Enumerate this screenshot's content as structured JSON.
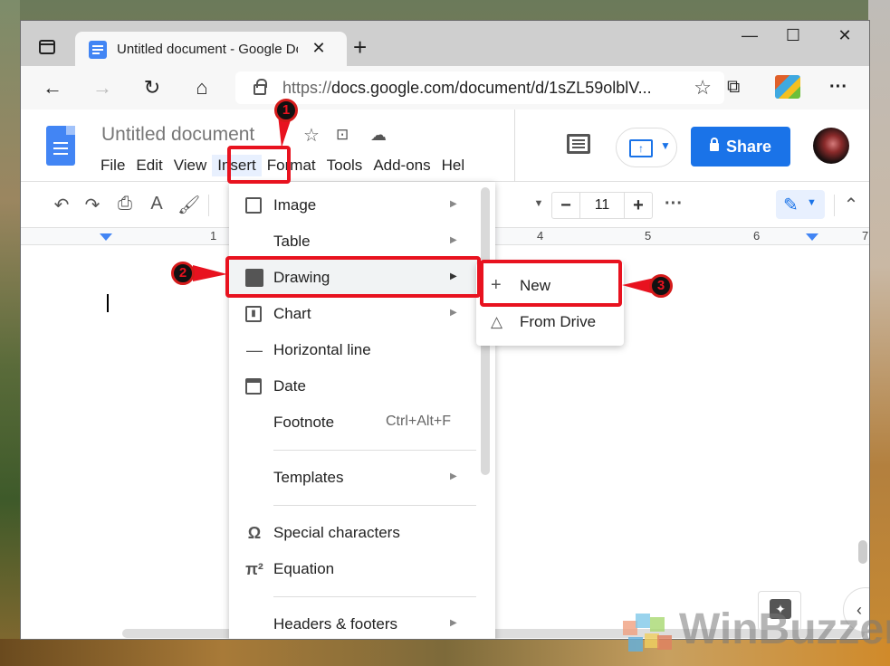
{
  "browser": {
    "tab_title": "Untitled document - Google Doc",
    "address_url_prefix": "https://",
    "address_url_rest": "docs.google.com/document/d/1sZL59olblV...",
    "window_controls": {
      "minimize": "—",
      "maximize": "☐",
      "close": "✕"
    }
  },
  "docs": {
    "doc_title": "Untitled document",
    "menubar": [
      "File",
      "Edit",
      "View",
      "Insert",
      "Format",
      "Tools",
      "Add-ons",
      "Hel"
    ],
    "active_menu": "Insert",
    "share_label": "Share",
    "font_size": "11",
    "ruler_numbers": [
      "1",
      "4",
      "5",
      "6",
      "7"
    ]
  },
  "insert_menu": {
    "items": [
      {
        "label": "Image",
        "icon": "image-icon",
        "has_submenu": true
      },
      {
        "label": "Table",
        "icon": "",
        "has_submenu": true
      },
      {
        "label": "Drawing",
        "icon": "drawing-icon",
        "has_submenu": true,
        "highlighted": true
      },
      {
        "label": "Chart",
        "icon": "chart-icon",
        "has_submenu": true
      },
      {
        "label": "Horizontal line",
        "icon": "horizontal-line-icon",
        "has_submenu": false
      },
      {
        "label": "Date",
        "icon": "calendar-icon",
        "has_submenu": false
      },
      {
        "label": "Footnote",
        "icon": "",
        "shortcut": "Ctrl+Alt+F",
        "has_submenu": false
      },
      {
        "label": "Templates",
        "icon": "",
        "has_submenu": true
      },
      {
        "label": "Special characters",
        "icon": "omega-icon",
        "has_submenu": false
      },
      {
        "label": "Equation",
        "icon": "pi-icon",
        "has_submenu": false
      },
      {
        "label": "Headers & footers",
        "icon": "",
        "has_submenu": true
      }
    ]
  },
  "drawing_submenu": {
    "items": [
      {
        "label": "New",
        "icon": "plus-icon"
      },
      {
        "label": "From Drive",
        "icon": "drive-icon"
      }
    ]
  },
  "annotations": {
    "steps": [
      "1",
      "2",
      "3"
    ],
    "color": "#e8121f"
  },
  "watermark": "WinBuzzer",
  "colors": {
    "share_blue": "#1a73e8",
    "docs_blue": "#4285f4",
    "menu_active_bg": "#e8f0fe",
    "annotation_red": "#e8121f"
  }
}
